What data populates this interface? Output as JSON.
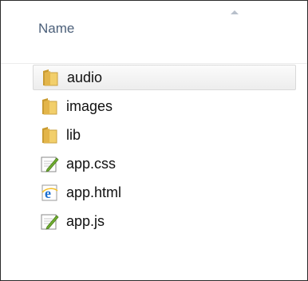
{
  "header": {
    "column_name": "Name"
  },
  "files": [
    {
      "label": "audio",
      "icon": "folder-icon",
      "selected": true
    },
    {
      "label": "images",
      "icon": "folder-icon",
      "selected": false
    },
    {
      "label": "lib",
      "icon": "folder-icon",
      "selected": false
    },
    {
      "label": "app.css",
      "icon": "css-file-icon",
      "selected": false
    },
    {
      "label": "app.html",
      "icon": "html-file-icon",
      "selected": false
    },
    {
      "label": "app.js",
      "icon": "js-file-icon",
      "selected": false
    }
  ],
  "colors": {
    "header_text": "#4c607a",
    "folder": "#e8c15c",
    "ie_blue": "#1a6fd0"
  }
}
